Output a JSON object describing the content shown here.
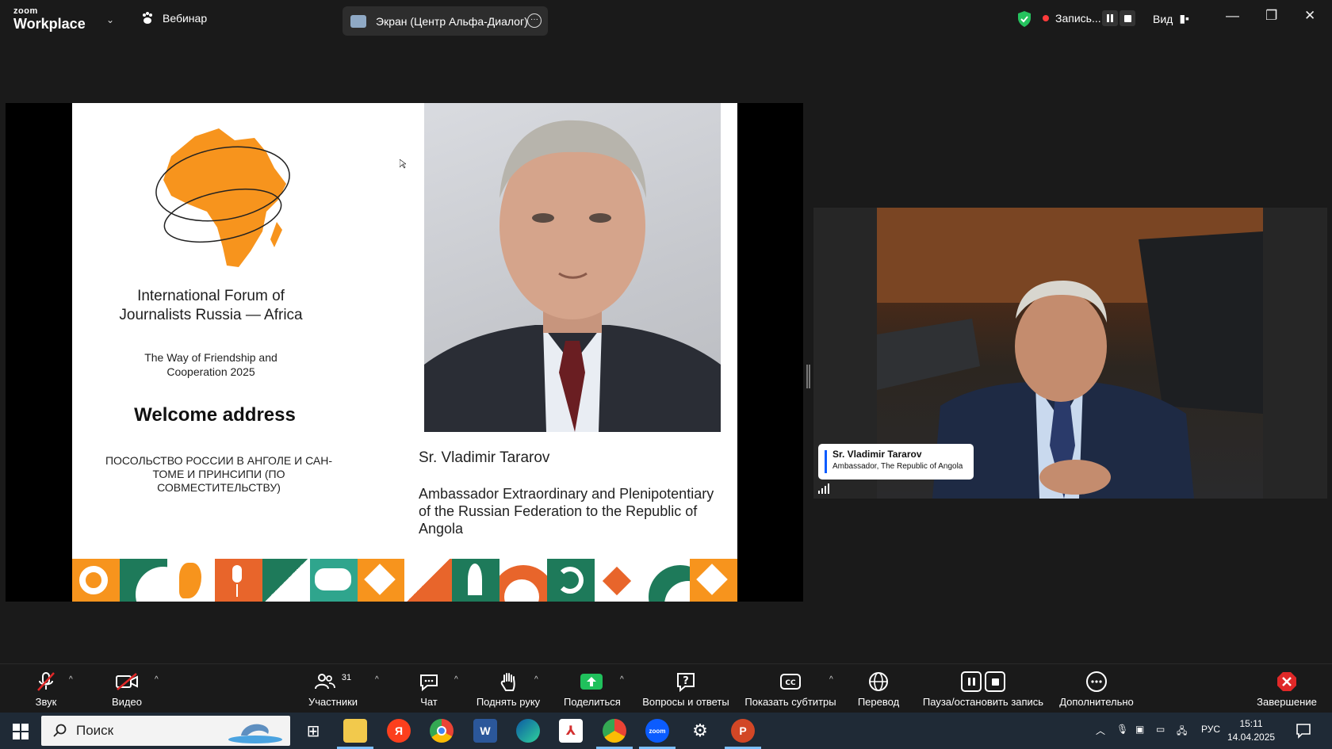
{
  "titlebar": {
    "logo_top": "zoom",
    "logo_bottom": "Workplace",
    "meeting_type": "Вебинар",
    "share_label": "Экран (Центр Альфа-Диалог)",
    "recording_label": "Запись...",
    "view_label": "Вид"
  },
  "slide": {
    "forum_title": "International Forum of Journalists Russia — Africa",
    "forum_subtitle": "The Way of Friendship and Cooperation 2025",
    "heading": "Welcome address",
    "embassy": "ПОСОЛЬСТВО РОССИИ В АНГОЛЕ И САН-ТОМЕ И ПРИНСИПИ (ПО СОВМЕСТИТЕЛЬСТВУ)",
    "speaker_name": "Sr. Vladimir Tararov",
    "speaker_role": "Ambassador Extraordinary and Plenipotentiary of the Russian Federation to the Republic of Angola"
  },
  "video": {
    "participant_name": "Sr. Vladimir Tararov",
    "participant_role": "Ambassador, The Republic of Angola"
  },
  "toolbar": {
    "audio": "Звук",
    "video": "Видео",
    "participants": "Участники",
    "participants_count": "31",
    "chat": "Чат",
    "raise_hand": "Поднять руку",
    "share": "Поделиться",
    "qa": "Вопросы и ответы",
    "captions": "Показать субтитры",
    "translate": "Перевод",
    "recording": "Пауза/остановить запись",
    "more": "Дополнительно",
    "end": "Завершение"
  },
  "taskbar": {
    "search_placeholder": "Поиск",
    "language": "РУС",
    "time": "15:11",
    "date": "14.04.2025"
  },
  "colors": {
    "brand_orange": "#f7941d",
    "brand_green": "#1e7a5a",
    "zoom_blue": "#0b5cff",
    "end_red": "#e02828"
  }
}
